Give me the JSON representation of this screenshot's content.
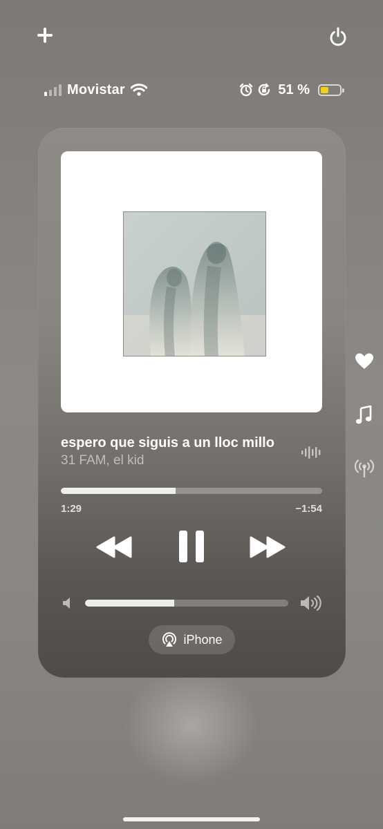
{
  "status_bar": {
    "carrier": "Movistar",
    "signal_bars_active": 1,
    "signal_bars_total": 4,
    "battery_percent_label": "51 %",
    "battery_level": 0.51,
    "battery_color": "#f4cf16",
    "icons": [
      "signal-icon",
      "wifi-icon",
      "alarm-icon",
      "orientation-lock-icon",
      "battery-icon"
    ]
  },
  "top_controls": {
    "add_icon": "plus-icon",
    "power_icon": "power-icon"
  },
  "now_playing": {
    "title": "espero que siguis a un lloc millo",
    "artist": "31 FAM, el kid",
    "elapsed": "1:29",
    "remaining": "−1:54",
    "progress": 0.44,
    "volume": 0.44,
    "route_label": "iPhone",
    "route_icon": "airplay-icon"
  },
  "side_icons": [
    "heart-icon",
    "music-note-icon",
    "broadcast-icon"
  ]
}
